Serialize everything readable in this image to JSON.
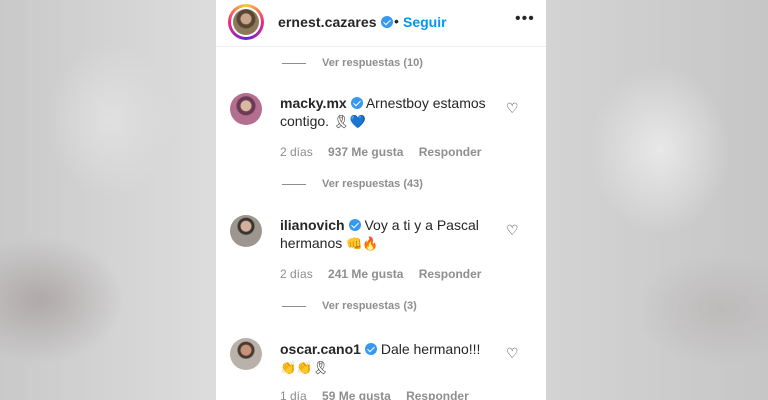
{
  "header": {
    "username": "ernest.cazares",
    "separator": "•",
    "follow_label": "Seguir",
    "more_icon": "•••"
  },
  "top_replies_label": "Ver respuestas (10)",
  "comments": [
    {
      "username": "macky.mx",
      "text": "Arnestboy estamos contigo.",
      "emojis": "🎗💙",
      "time": "2 días",
      "likes": "937 Me gusta",
      "reply": "Responder",
      "replies_label": "Ver respuestas (43)"
    },
    {
      "username": "ilianovich",
      "text": "Voy a ti y a Pascal hermanos",
      "emojis": "👊🔥",
      "time": "2 días",
      "likes": "241 Me gusta",
      "reply": "Responder",
      "replies_label": "Ver respuestas (3)"
    },
    {
      "username": "oscar.cano1",
      "text": "Dale hermano!!!",
      "emojis": "👏👏🎗",
      "time": "1 día",
      "likes": "59 Me gusta",
      "reply": "Responder"
    }
  ],
  "colors": {
    "link_blue": "#0095f6",
    "verified": "#3897f0",
    "muted": "#8e8e8e",
    "text": "#262626"
  }
}
